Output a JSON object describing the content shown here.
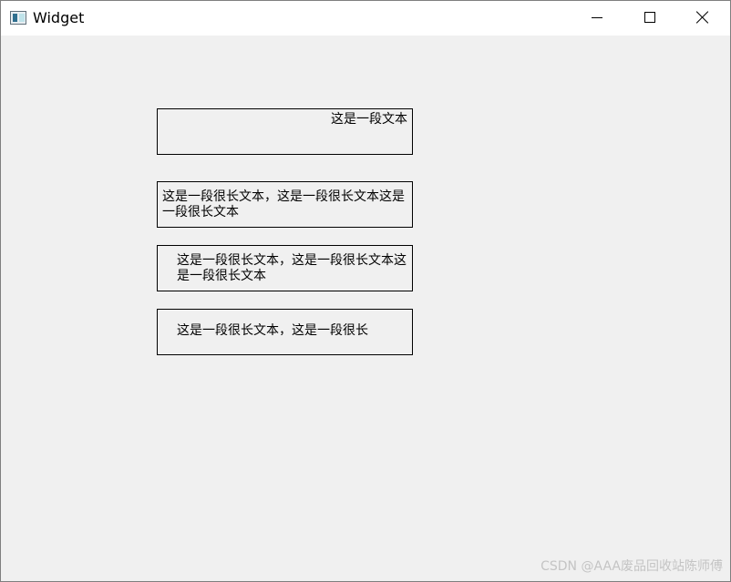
{
  "window": {
    "title": "Widget",
    "icon": "app-window-icon",
    "controls": {
      "minimize_icon": "minimize-icon",
      "maximize_icon": "maximize-icon",
      "close_icon": "close-icon"
    }
  },
  "labels": [
    {
      "text": "这是一段文本",
      "alignment": "right-top"
    },
    {
      "text": "这是一段很长文本，这是一段很长文本这是一段很长文本",
      "alignment": "left-wrapped"
    },
    {
      "text": "这是一段很长文本，这是一段很长文本这是一段很长文本",
      "alignment": "indented-wrapped"
    },
    {
      "text": "这是一段很长文本，这是一段很长",
      "alignment": "clipped"
    }
  ],
  "watermark": "CSDN @AAA废品回收站陈师傅",
  "colors": {
    "background": "#f0f0f0",
    "titlebar": "#ffffff",
    "border": "#000000"
  }
}
